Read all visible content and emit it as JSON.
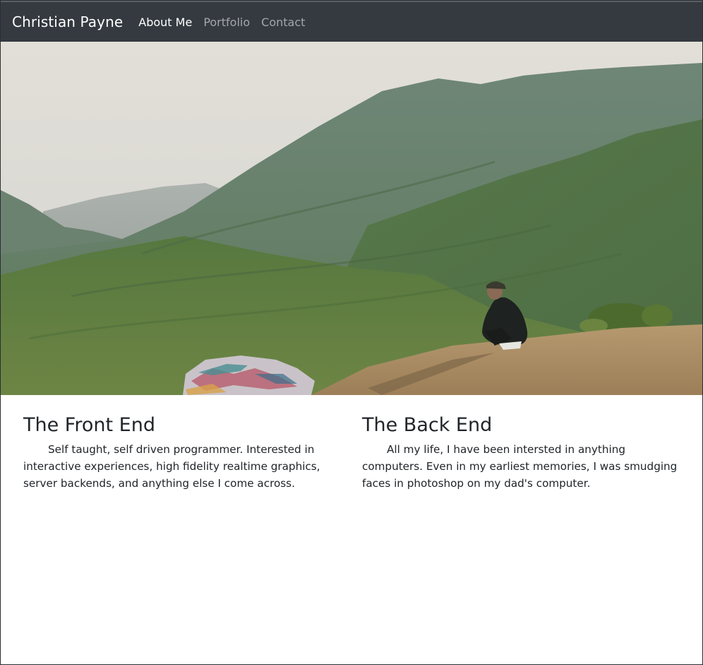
{
  "navbar": {
    "brand": "Christian Payne",
    "links": [
      {
        "label": "About Me",
        "active": true
      },
      {
        "label": "Portfolio",
        "active": false
      },
      {
        "label": "Contact",
        "active": false
      }
    ]
  },
  "sections": {
    "front_end": {
      "title": "The Front End",
      "body": "Self taught, self driven programmer. Interested in interactive experiences, high fidelity realtime graphics, server backends, and anything else I come across."
    },
    "back_end": {
      "title": "The Back End",
      "body": "All my life, I have been intersted in anything computers. Even in my earliest memories, I was smudging faces in photoshop on my dad's computer."
    }
  },
  "colors": {
    "navbar_bg": "#343a40",
    "text": "#212529",
    "nav_inactive": "rgba(255,255,255,0.55)"
  }
}
